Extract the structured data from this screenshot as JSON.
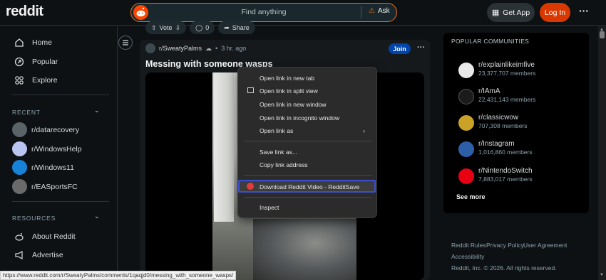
{
  "header": {
    "logo": "reddit",
    "search_placeholder": "Find anything",
    "ask_label": "Ask",
    "get_app_label": "Get App",
    "login_label": "Log In"
  },
  "sidebar": {
    "nav": [
      {
        "label": "Home",
        "icon": "home-icon"
      },
      {
        "label": "Popular",
        "icon": "popular-icon"
      },
      {
        "label": "Explore",
        "icon": "explore-icon"
      }
    ],
    "recent_heading": "RECENT",
    "recent": [
      {
        "label": "r/datarecovery",
        "color": "#5a6468"
      },
      {
        "label": "r/WindowsHelp",
        "color": "#b9c4f0"
      },
      {
        "label": "r/Windows11",
        "color": "#1683d8"
      },
      {
        "label": "r/EASportsFC",
        "color": "#6a6a6a"
      }
    ],
    "resources_heading": "RESOURCES",
    "resources": [
      {
        "label": "About Reddit",
        "icon": "reddit-alien-icon"
      },
      {
        "label": "Advertise",
        "icon": "megaphone-icon"
      }
    ]
  },
  "feed": {
    "actions": {
      "vote": "Vote",
      "comments": "0",
      "share": "Share"
    },
    "post": {
      "subreddit": "r/SweatyPalms",
      "time": "3 hr. ago",
      "join": "Join",
      "title": "Messing with someone wasps"
    }
  },
  "context_menu": {
    "items": [
      "Open link in new tab",
      "Open link in split view",
      "Open link in new window",
      "Open link in incognito window",
      "Open link as",
      "Save link as...",
      "Copy link address",
      "Download Reddit Video - RedditSave",
      "Inspect"
    ]
  },
  "popular_communities": {
    "heading": "POPULAR COMMUNITIES",
    "items": [
      {
        "name": "r/explainlikeimfive",
        "members": "23,377,707 members",
        "color": "#e9e9e9"
      },
      {
        "name": "r/IAmA",
        "members": "22,431,143 members",
        "color": "#1b1b1b"
      },
      {
        "name": "r/classicwow",
        "members": "707,308 members",
        "color": "#c9a227"
      },
      {
        "name": "r/Instagram",
        "members": "1,016,860 members",
        "color": "#2d5fa8"
      },
      {
        "name": "r/NintendoSwitch",
        "members": "7,883,017 members",
        "color": "#e60012"
      }
    ],
    "see_more": "See more"
  },
  "footer": {
    "links": [
      "Reddit Rules",
      "Privacy Policy",
      "User Agreement",
      "Accessibility"
    ],
    "copyright": "Reddit, Inc. © 2026. All rights reserved."
  },
  "status_url": "https://www.reddit.com/r/SweatyPalms/comments/1qaqjd0/messing_with_someone_wasps/",
  "colors": {
    "accent": "#d93900",
    "join": "#0045ac",
    "highlight": "#3b4fcc"
  }
}
